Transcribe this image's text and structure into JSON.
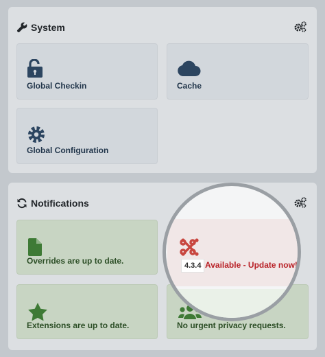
{
  "system": {
    "title": "System",
    "tiles": [
      {
        "label": "Global Checkin",
        "icon": "unlock-icon"
      },
      {
        "label": "Cache",
        "icon": "cloud-icon"
      },
      {
        "label": "Global Configuration",
        "icon": "cog-icon"
      }
    ]
  },
  "notifications": {
    "title": "Notifications",
    "tiles": [
      {
        "label": "Overrides are up to date.",
        "icon": "file-icon"
      },
      {
        "label": "Extensions are up to date.",
        "icon": "star-icon"
      },
      {
        "label": "No urgent privacy requests.",
        "icon": "users-icon"
      }
    ],
    "update": {
      "version": "4.3.4",
      "text": "Available - Update now!",
      "icon": "joomla-logo-icon"
    }
  },
  "colors": {
    "accent_dark": "#22364b",
    "success": "#2c4e26",
    "alert_red": "#b92228",
    "joomla_red": "#c8463f"
  }
}
